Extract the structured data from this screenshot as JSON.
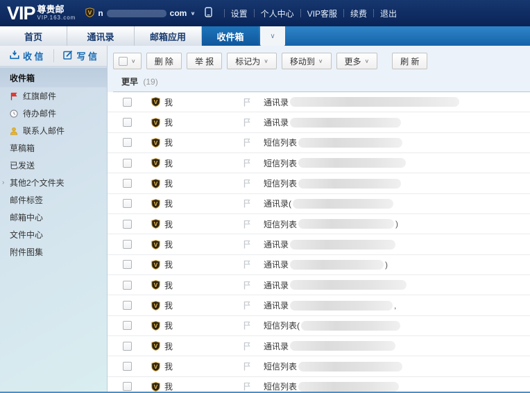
{
  "colors": {
    "accent_blue": "#1569b3",
    "tabbar_blue_top": "#2f85c8",
    "tabbar_blue_bottom": "#1563a9",
    "active_tab_top": "#1e74ba",
    "active_tab_bottom": "#0f569c",
    "toolbar_bg": "#ebf2fa",
    "row_border": "#e9ebee",
    "flag_red": "#e23b30",
    "contact_gold": "#e7b62c",
    "vip_gold": "#c79b3b"
  },
  "header": {
    "logo": {
      "vip": "VIP",
      "brand": "尊贵邮",
      "domain": "VIP.163.com"
    },
    "account": {
      "email_prefix": "n",
      "email_suffix": "com"
    },
    "links": [
      "设置",
      "个人中心",
      "VIP客服",
      "续费",
      "退出"
    ]
  },
  "tabs": {
    "items": [
      "首页",
      "通讯录",
      "邮箱应用",
      "收件箱"
    ],
    "active": "收件箱"
  },
  "sidebar": {
    "receive_label": "收 信",
    "write_label": "写 信",
    "folders": [
      {
        "label": "收件箱",
        "selected": true
      },
      {
        "label": "红旗邮件",
        "icon": "flag-red"
      },
      {
        "label": "待办邮件",
        "icon": "clock"
      },
      {
        "label": "联系人邮件",
        "icon": "person"
      },
      {
        "label": "草稿箱"
      },
      {
        "label": "已发送"
      },
      {
        "label": "其他2个文件夹",
        "caret": true
      },
      {
        "label": "邮件标签"
      },
      {
        "label": "邮箱中心"
      },
      {
        "label": "文件中心"
      },
      {
        "label": "附件图集"
      }
    ]
  },
  "toolbar": {
    "buttons": [
      {
        "label": "删 除"
      },
      {
        "label": "举 报"
      },
      {
        "label": "标记为",
        "dropdown": true
      },
      {
        "label": "移动到",
        "dropdown": true
      },
      {
        "label": "更多",
        "dropdown": true
      },
      {
        "label": "刷 新",
        "gap_before": true
      }
    ]
  },
  "list": {
    "group_label": "更早",
    "group_count": "(19)",
    "sender": "我",
    "rows": [
      {
        "prefix": "通讯录",
        "redacted_width": 244,
        "suffix": ""
      },
      {
        "prefix": "通讯录",
        "redacted_width": 160,
        "suffix": ""
      },
      {
        "prefix": "短信列表",
        "redacted_width": 150,
        "suffix": ""
      },
      {
        "prefix": "短信列表",
        "redacted_width": 155,
        "suffix": ""
      },
      {
        "prefix": "短信列表",
        "redacted_width": 148,
        "suffix": ""
      },
      {
        "prefix": "通讯录(",
        "redacted_width": 145,
        "suffix": ""
      },
      {
        "prefix": "短信列表",
        "redacted_width": 138,
        "suffix": ")"
      },
      {
        "prefix": "通讯录",
        "redacted_width": 152,
        "suffix": ""
      },
      {
        "prefix": "通讯录",
        "redacted_width": 135,
        "suffix": ")"
      },
      {
        "prefix": "通讯录",
        "redacted_width": 168,
        "suffix": ""
      },
      {
        "prefix": "通讯录",
        "redacted_width": 148,
        "suffix": ","
      },
      {
        "prefix": "短信列表(",
        "redacted_width": 143,
        "suffix": ""
      },
      {
        "prefix": "通讯录",
        "redacted_width": 152,
        "suffix": ""
      },
      {
        "prefix": "短信列表",
        "redacted_width": 150,
        "suffix": ""
      },
      {
        "prefix": "短信列表",
        "redacted_width": 145,
        "suffix": ""
      }
    ]
  }
}
